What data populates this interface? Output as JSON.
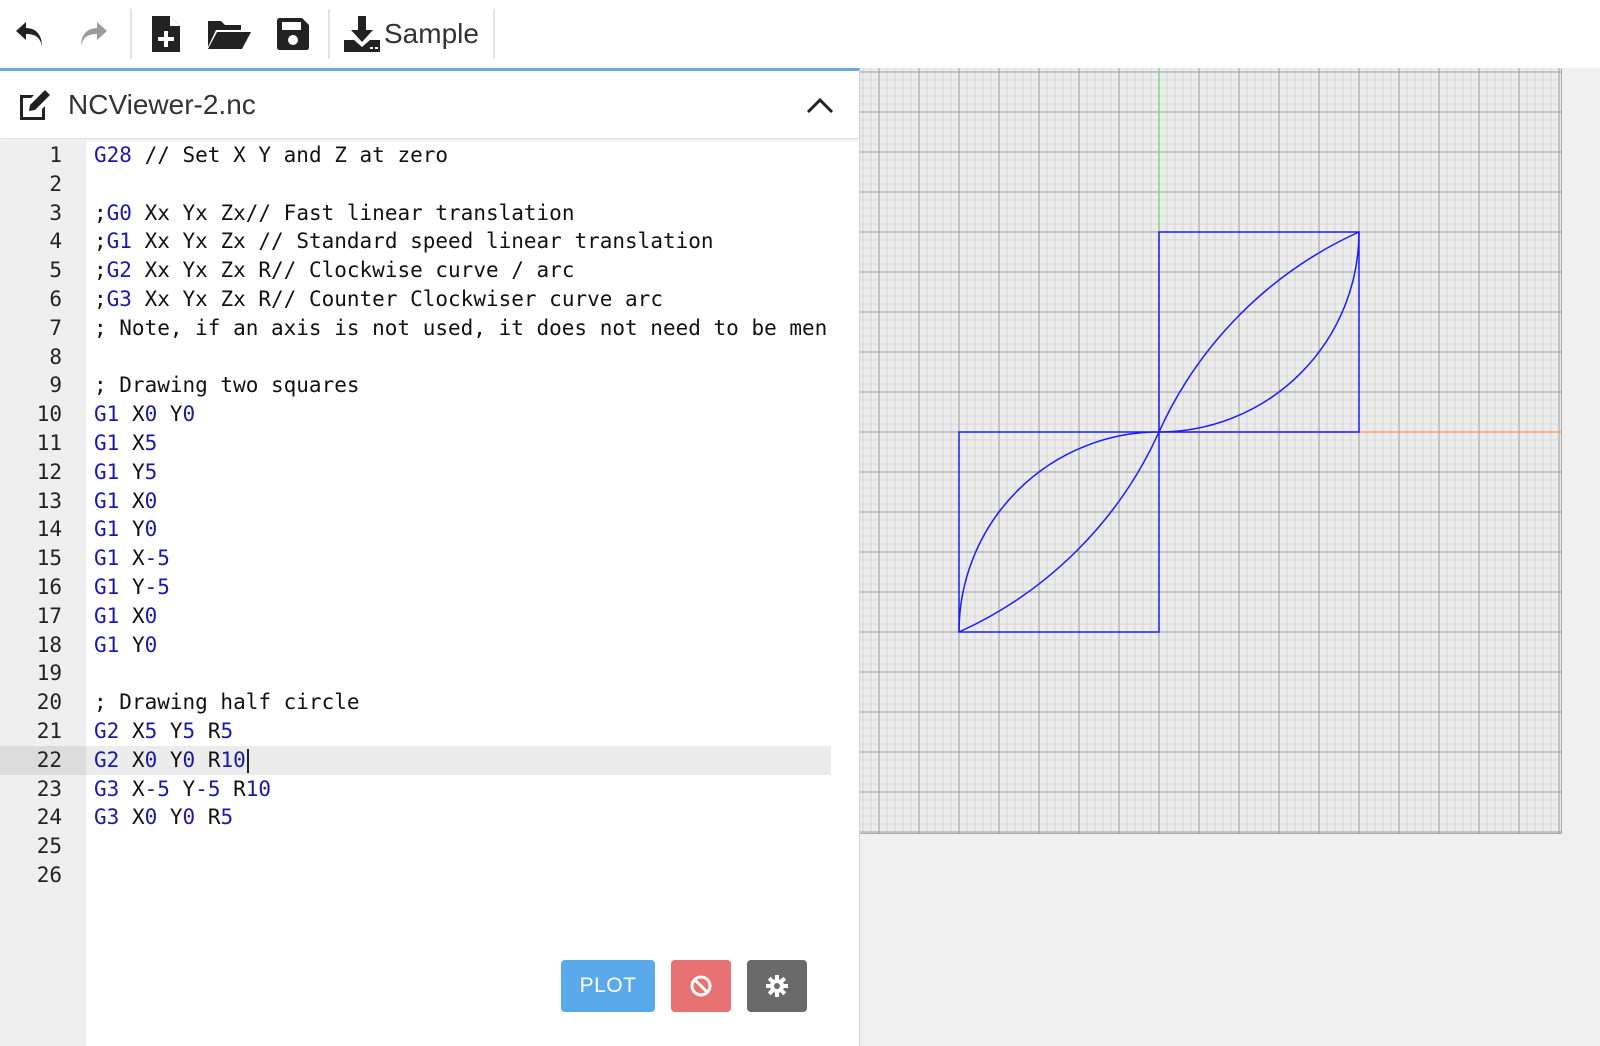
{
  "toolbar": {
    "undo_icon": "undo-icon",
    "redo_icon": "redo-icon",
    "new_icon": "new-file-icon",
    "open_icon": "folder-open-icon",
    "save_icon": "save-icon",
    "sample_icon": "download-icon",
    "sample_label": "Sample"
  },
  "editor": {
    "file_name": "NCViewer-2.nc",
    "active_line": 22,
    "lines": [
      {
        "n": "1",
        "tokens": [
          [
            "c",
            "G28"
          ],
          [
            "t",
            " // Set X Y and Z at zero"
          ]
        ]
      },
      {
        "n": "2",
        "tokens": []
      },
      {
        "n": "3",
        "tokens": [
          [
            "t",
            ";"
          ],
          [
            "c",
            "G0"
          ],
          [
            "t",
            " Xx Yx Zx// Fast linear translation"
          ]
        ]
      },
      {
        "n": "4",
        "tokens": [
          [
            "t",
            ";"
          ],
          [
            "c",
            "G1"
          ],
          [
            "t",
            " Xx Yx Zx // Standard speed linear translation"
          ]
        ]
      },
      {
        "n": "5",
        "tokens": [
          [
            "t",
            ";"
          ],
          [
            "c",
            "G2"
          ],
          [
            "t",
            " Xx Yx Zx R// Clockwise curve / arc"
          ]
        ]
      },
      {
        "n": "6",
        "tokens": [
          [
            "t",
            ";"
          ],
          [
            "c",
            "G3"
          ],
          [
            "t",
            " Xx Yx Zx R// Counter Clockwiser curve arc"
          ]
        ]
      },
      {
        "n": "7",
        "tokens": [
          [
            "t",
            "; Note, if an axis is not used, it does not need to be men"
          ]
        ]
      },
      {
        "n": "8",
        "tokens": []
      },
      {
        "n": "9",
        "tokens": [
          [
            "t",
            "; Drawing two squares"
          ]
        ]
      },
      {
        "n": "10",
        "tokens": [
          [
            "c",
            "G1"
          ],
          [
            "t",
            " X"
          ],
          [
            "c",
            "0"
          ],
          [
            "t",
            " Y"
          ],
          [
            "c",
            "0"
          ]
        ]
      },
      {
        "n": "11",
        "tokens": [
          [
            "c",
            "G1"
          ],
          [
            "t",
            " X"
          ],
          [
            "c",
            "5"
          ]
        ]
      },
      {
        "n": "12",
        "tokens": [
          [
            "c",
            "G1"
          ],
          [
            "t",
            " Y"
          ],
          [
            "c",
            "5"
          ]
        ]
      },
      {
        "n": "13",
        "tokens": [
          [
            "c",
            "G1"
          ],
          [
            "t",
            " X"
          ],
          [
            "c",
            "0"
          ]
        ]
      },
      {
        "n": "14",
        "tokens": [
          [
            "c",
            "G1"
          ],
          [
            "t",
            " Y"
          ],
          [
            "c",
            "0"
          ]
        ]
      },
      {
        "n": "15",
        "tokens": [
          [
            "c",
            "G1"
          ],
          [
            "t",
            " X"
          ],
          [
            "c",
            "-5"
          ]
        ]
      },
      {
        "n": "16",
        "tokens": [
          [
            "c",
            "G1"
          ],
          [
            "t",
            " Y"
          ],
          [
            "c",
            "-5"
          ]
        ]
      },
      {
        "n": "17",
        "tokens": [
          [
            "c",
            "G1"
          ],
          [
            "t",
            " X"
          ],
          [
            "c",
            "0"
          ]
        ]
      },
      {
        "n": "18",
        "tokens": [
          [
            "c",
            "G1"
          ],
          [
            "t",
            " Y"
          ],
          [
            "c",
            "0"
          ]
        ]
      },
      {
        "n": "19",
        "tokens": []
      },
      {
        "n": "20",
        "tokens": [
          [
            "t",
            "; Drawing half circle"
          ]
        ]
      },
      {
        "n": "21",
        "tokens": [
          [
            "c",
            "G2"
          ],
          [
            "t",
            " X"
          ],
          [
            "c",
            "5"
          ],
          [
            "t",
            " Y"
          ],
          [
            "c",
            "5"
          ],
          [
            "t",
            " R"
          ],
          [
            "c",
            "5"
          ]
        ]
      },
      {
        "n": "22",
        "tokens": [
          [
            "c",
            "G2"
          ],
          [
            "t",
            " X"
          ],
          [
            "c",
            "0"
          ],
          [
            "t",
            " Y"
          ],
          [
            "c",
            "0"
          ],
          [
            "t",
            " R"
          ],
          [
            "c",
            "10"
          ]
        ]
      },
      {
        "n": "23",
        "tokens": [
          [
            "c",
            "G3"
          ],
          [
            "t",
            " X"
          ],
          [
            "c",
            "-5"
          ],
          [
            "t",
            " Y"
          ],
          [
            "c",
            "-5"
          ],
          [
            "t",
            " R"
          ],
          [
            "c",
            "10"
          ]
        ]
      },
      {
        "n": "24",
        "tokens": [
          [
            "c",
            "G3"
          ],
          [
            "t",
            " X"
          ],
          [
            "c",
            "0"
          ],
          [
            "t",
            " Y"
          ],
          [
            "c",
            "0"
          ],
          [
            "t",
            " R"
          ],
          [
            "c",
            "5"
          ]
        ]
      },
      {
        "n": "25",
        "tokens": []
      },
      {
        "n": "26",
        "tokens": []
      }
    ]
  },
  "actions": {
    "plot_label": "PLOT",
    "stop_icon": "ban-icon",
    "settings_icon": "gear-icon"
  },
  "plot": {
    "colors": {
      "path": "#1a1aff",
      "y_axis": "#7dd87d",
      "x_axis": "#f0a070",
      "grid_minor": "#c8c8c8",
      "grid_major": "#9a9a9a"
    },
    "toolpath": {
      "squares": [
        [
          [
            0,
            0
          ],
          [
            5,
            0
          ],
          [
            5,
            5
          ],
          [
            0,
            5
          ],
          [
            0,
            0
          ]
        ],
        [
          [
            0,
            0
          ],
          [
            -5,
            0
          ],
          [
            -5,
            -5
          ],
          [
            0,
            -5
          ],
          [
            0,
            0
          ]
        ]
      ],
      "arcs": [
        {
          "from": [
            0,
            0
          ],
          "to": [
            5,
            5
          ],
          "r": 5,
          "dir": "G2"
        },
        {
          "from": [
            5,
            5
          ],
          "to": [
            0,
            0
          ],
          "r": 10,
          "dir": "G2"
        },
        {
          "from": [
            0,
            0
          ],
          "to": [
            -5,
            -5
          ],
          "r": 10,
          "dir": "G3"
        },
        {
          "from": [
            -5,
            -5
          ],
          "to": [
            0,
            0
          ],
          "r": 5,
          "dir": "G3"
        }
      ]
    }
  }
}
